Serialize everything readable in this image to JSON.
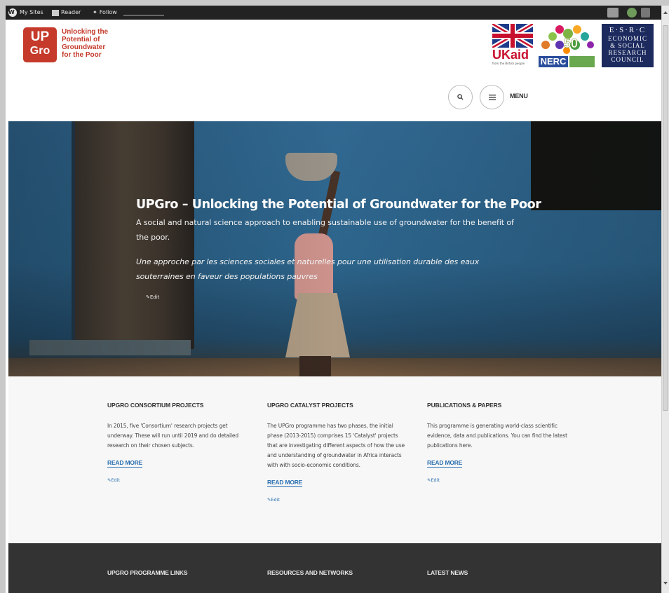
{
  "admin_bar": {
    "my_sites": "My Sites",
    "reader": "Reader",
    "follow": "Follow"
  },
  "header": {
    "logo_line1": "UP",
    "logo_line2": "Gro",
    "tagline": [
      "Unlocking the",
      "Potential of",
      "Groundwater",
      "for the Poor"
    ],
    "partners": {
      "ukaid": "UKaid",
      "ukaid_sub": "from the British people",
      "nerc": "NERC",
      "esrc_lines": [
        "E·S·R·C",
        "ECONOMIC",
        "& SOCIAL",
        "RESEARCH",
        "COUNCIL"
      ]
    },
    "menu_label": "MENU"
  },
  "hero": {
    "title": "UPGro – Unlocking the Potential of Groundwater for the Poor",
    "subtitle": "A social and natural science approach to enabling sustainable use of groundwater for the benefit of the poor.",
    "subtitle_fr": "Une approche par les sciences sociales et naturelles pour une utilisation durable des eaux souterraines en faveur des populations pauvres",
    "edit": "Edit"
  },
  "features": [
    {
      "heading": "UPGRO CONSORTIUM PROJECTS",
      "body": "In 2015, five 'Consortium' research projects get underway. These will run until 2019 and do detailed research on their chosen subjects.",
      "read_more": "READ MORE",
      "edit": "Edit"
    },
    {
      "heading": "UPGRO CATALYST PROJECTS",
      "body": "The UPGro programme has two phases, the initial phase (2013-2015) comprises 15 'Catalyst' projects that are investigating different aspects of how the use and understanding of groundwater in Africa interacts with with socio-economic conditions.",
      "read_more": "READ MORE",
      "edit": "Edit"
    },
    {
      "heading": "PUBLICATIONS & PAPERS",
      "body": "This programme is generating world-class scientific evidence, data and publications. You can find the latest publications here.",
      "read_more": "READ MORE",
      "edit": "Edit"
    }
  ],
  "footer": {
    "headings": [
      "UPGRO PROGRAMME LINKS",
      "RESOURCES AND NETWORKS",
      "LATEST NEWS"
    ]
  },
  "colors": {
    "brand_red": "#c53a2b",
    "link_blue": "#2a6fb0",
    "footer_bg": "#333333",
    "admin_bar_bg": "#222222"
  }
}
